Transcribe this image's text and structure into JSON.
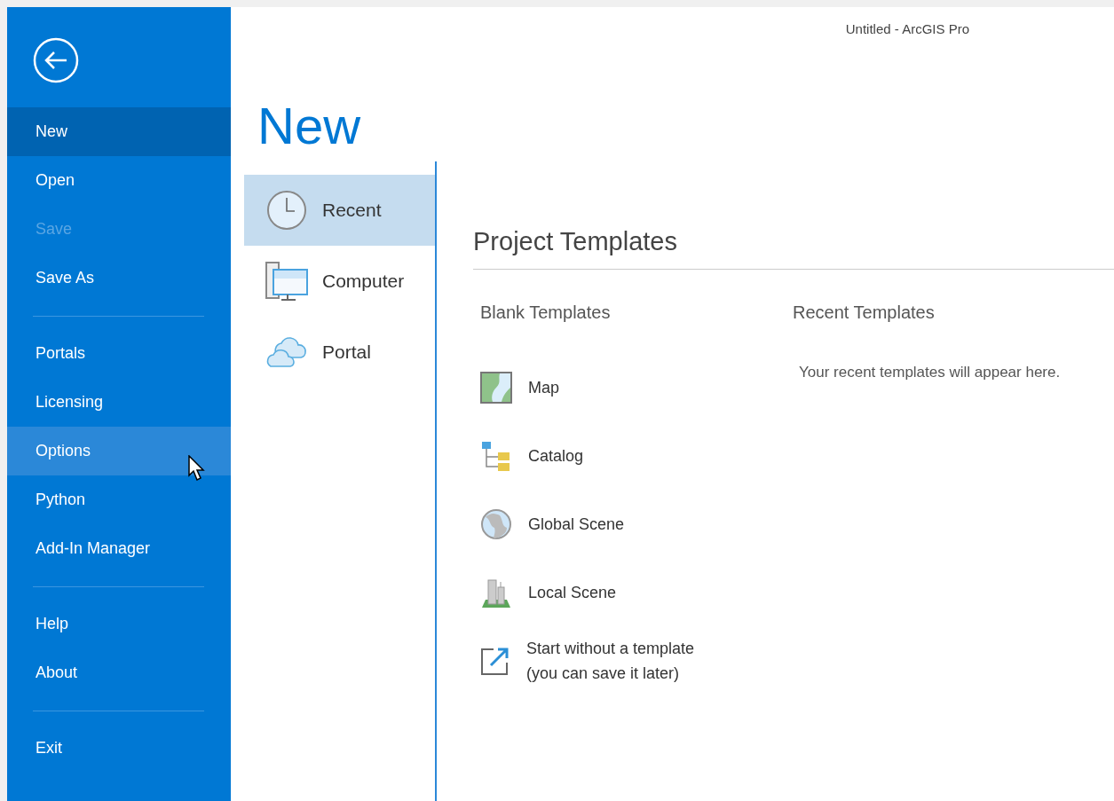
{
  "window": {
    "title": "Untitled - ArcGIS Pro"
  },
  "sidebar": {
    "items": [
      {
        "kind": "item",
        "label": "New",
        "selected": true,
        "disabled": false,
        "hovered": false
      },
      {
        "kind": "item",
        "label": "Open",
        "selected": false,
        "disabled": false,
        "hovered": false
      },
      {
        "kind": "item",
        "label": "Save",
        "selected": false,
        "disabled": true,
        "hovered": false
      },
      {
        "kind": "item",
        "label": "Save As",
        "selected": false,
        "disabled": false,
        "hovered": false
      },
      {
        "kind": "separator"
      },
      {
        "kind": "item",
        "label": "Portals",
        "selected": false,
        "disabled": false,
        "hovered": false
      },
      {
        "kind": "item",
        "label": "Licensing",
        "selected": false,
        "disabled": false,
        "hovered": false
      },
      {
        "kind": "item",
        "label": "Options",
        "selected": false,
        "disabled": false,
        "hovered": true
      },
      {
        "kind": "item",
        "label": "Python",
        "selected": false,
        "disabled": false,
        "hovered": false
      },
      {
        "kind": "item",
        "label": "Add-In Manager",
        "selected": false,
        "disabled": false,
        "hovered": false
      },
      {
        "kind": "separator"
      },
      {
        "kind": "item",
        "label": "Help",
        "selected": false,
        "disabled": false,
        "hovered": false
      },
      {
        "kind": "item",
        "label": "About",
        "selected": false,
        "disabled": false,
        "hovered": false
      },
      {
        "kind": "separator"
      },
      {
        "kind": "item",
        "label": "Exit",
        "selected": false,
        "disabled": false,
        "hovered": false
      }
    ]
  },
  "page_title": "New",
  "locations": [
    {
      "kind": "clock",
      "label": "Recent",
      "selected": true
    },
    {
      "kind": "computer",
      "label": "Computer",
      "selected": false
    },
    {
      "kind": "cloud",
      "label": "Portal",
      "selected": false
    }
  ],
  "section_title": "Project Templates",
  "blank_templates": {
    "heading": "Blank Templates",
    "items": [
      {
        "kind": "map",
        "label": "Map"
      },
      {
        "kind": "catalog",
        "label": "Catalog"
      },
      {
        "kind": "globe",
        "label": "Global Scene"
      },
      {
        "kind": "local",
        "label": "Local Scene"
      },
      {
        "kind": "none",
        "label": "Start without a template\n(you can save it later)"
      }
    ]
  },
  "recent_templates": {
    "heading": "Recent Templates",
    "message": "Your recent templates will appear here."
  }
}
